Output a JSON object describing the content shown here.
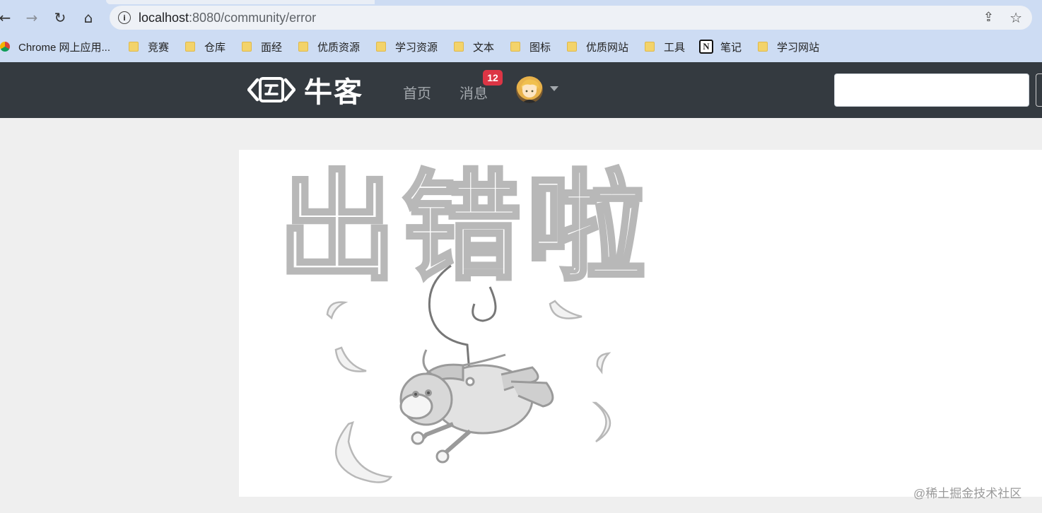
{
  "browser": {
    "url_host": "localhost",
    "url_rest": ":8080/community/error",
    "nav_icons": [
      "back-arrow-icon",
      "forward-arrow-icon",
      "reload-icon",
      "home-icon"
    ],
    "bookmarks": [
      {
        "label": "Chrome 网上应用...",
        "icon": "chrome-logo"
      },
      {
        "label": "竞赛",
        "icon": "folder-icon"
      },
      {
        "label": "仓库",
        "icon": "folder-icon"
      },
      {
        "label": "面经",
        "icon": "folder-icon"
      },
      {
        "label": "优质资源",
        "icon": "folder-icon"
      },
      {
        "label": "学习资源",
        "icon": "folder-icon"
      },
      {
        "label": "文本",
        "icon": "folder-icon"
      },
      {
        "label": "图标",
        "icon": "folder-icon"
      },
      {
        "label": "优质网站",
        "icon": "folder-icon"
      },
      {
        "label": "工具",
        "icon": "folder-icon"
      },
      {
        "label": "笔记",
        "icon": "notion-icon"
      },
      {
        "label": "学习网站",
        "icon": "folder-icon"
      }
    ]
  },
  "site": {
    "brand": "牛客",
    "nav": {
      "home": "首页",
      "messages": "消息",
      "messages_badge": "12"
    },
    "search": {
      "placeholder": ""
    }
  },
  "error_page": {
    "title_text": "出错啦"
  },
  "watermark": "@稀土掘金技术社区",
  "colors": {
    "navbar": "#343a40",
    "badge": "#dc3545",
    "chrome_toolbar": "#cddcf3"
  }
}
